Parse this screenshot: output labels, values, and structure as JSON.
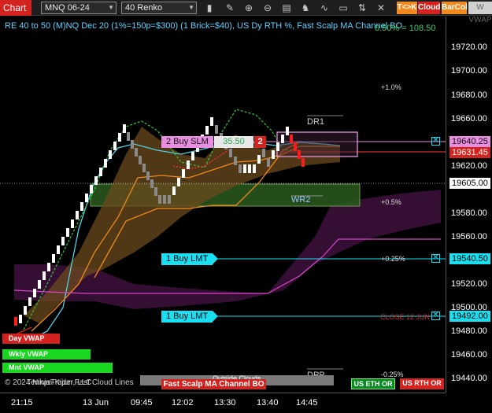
{
  "toolbar": {
    "chart_tab": "Chart",
    "instrument": "MNQ 06-24",
    "period": "40 Renko",
    "icons": [
      "bar-style-icon",
      "draw-pencil-icon",
      "zoom-in-icon",
      "zoom-out-icon",
      "properties-icon",
      "strategy-icon",
      "indicator-icon",
      "template-icon",
      "chart-trader-icon",
      "cross-icon"
    ],
    "tk_label": "T<>K",
    "cloud_label": "Cloud",
    "barcol_label": "BarCol",
    "vwap_label": "W VWAP"
  },
  "chart": {
    "title": "RE 40 to 50 (M)NQ Dec 20 (1%=150p=$300) (1 Brick=$40), US Dy RTH %, Fast Scalp MA Channel BO",
    "top_value": "0.50% = 108.50",
    "pct_labels": [
      "+1.0%",
      "+0.5%",
      "+0.25%",
      "-0.25%"
    ],
    "close_label": "CLOSE 12 JUN",
    "dr1": "DR1",
    "wr2": "WR2",
    "dpp": "DPP",
    "order_buy_slm": "2 Buy SLM",
    "order_buy_slm_value": "35.50",
    "order_buy_slm_qty": "2",
    "order_buy_lmt_1": "1 Buy LMT",
    "order_buy_lmt_2": "1 Buy LMT",
    "vwap_tags": [
      "Day VWAP",
      "Wkly VWAP",
      "Mnt VWAP"
    ],
    "copyright": "© 2024 NinjaTrader, LLC",
    "overlay_text": "Tenkan-Kijun Fast Cloud Lines",
    "outside_clouds": "Outside Clouds",
    "fast_scalp_tag": "Fast Scalp MA Channel BO",
    "us_eth_or": "US ETH OR",
    "us_rth_or": "US RTH OR"
  },
  "y_axis": {
    "ticks": [
      "19720.00",
      "19700.00",
      "19680.00",
      "19660.00",
      "19620.00",
      "19580.00",
      "19560.00",
      "19520.00",
      "19500.00",
      "19480.00",
      "19460.00",
      "19440.00"
    ],
    "flag_order_top": "19640.25",
    "flag_sell": "19631.45",
    "flag_last": "19605.00",
    "flag_lmt_1": "19540.50",
    "flag_lmt_2": "19492.00"
  },
  "x_axis": {
    "ticks": [
      "21:15",
      "13 Jun",
      "09:45",
      "12:02",
      "13:30",
      "13:40",
      "14:45"
    ]
  },
  "colors": {
    "up_brick": "#ffffff",
    "down_brick": "#ff1a1a",
    "order_line": "#19dff0",
    "accent_red": "#d4231f",
    "accent_orange": "#f08a1e",
    "title": "#5fd3ff"
  }
}
